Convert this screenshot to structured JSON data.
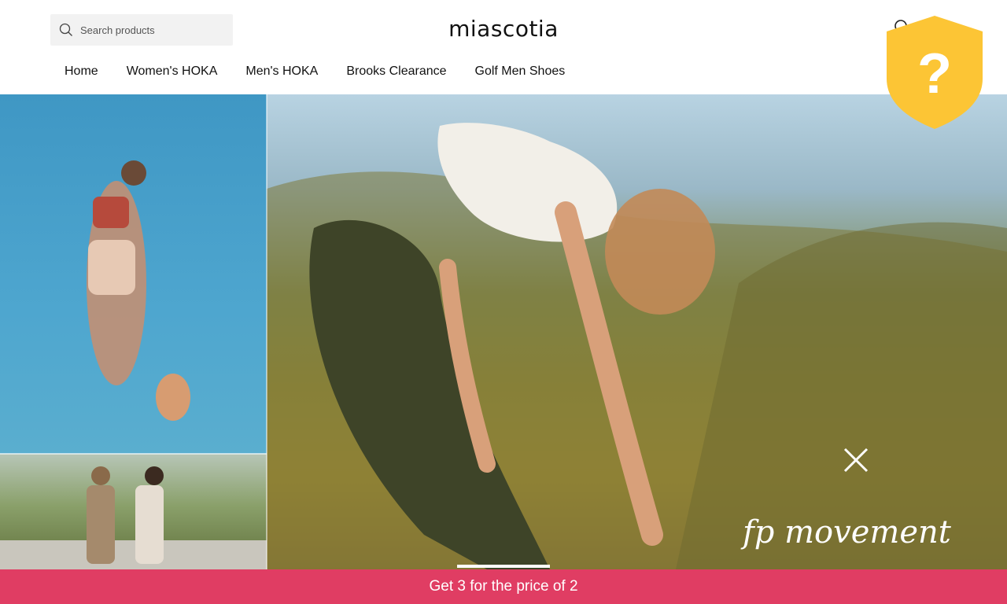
{
  "header": {
    "logo": "miascotia",
    "search_placeholder": "Search products"
  },
  "nav": {
    "items": [
      {
        "label": "Home"
      },
      {
        "label": "Women's HOKA"
      },
      {
        "label": "Men's HOKA"
      },
      {
        "label": "Brooks Clearance"
      },
      {
        "label": "Golf Men Shoes"
      }
    ]
  },
  "hero": {
    "signature_text": "fp movement",
    "slides": 1,
    "active_slide": 1
  },
  "promo": {
    "text": "Get 3 for the price of 2",
    "color": "#e03d63"
  },
  "shield_badge": {
    "symbol": "?",
    "color": "#fcc535"
  },
  "icons": [
    "search-icon",
    "help-shield-icon",
    "close-icon"
  ]
}
